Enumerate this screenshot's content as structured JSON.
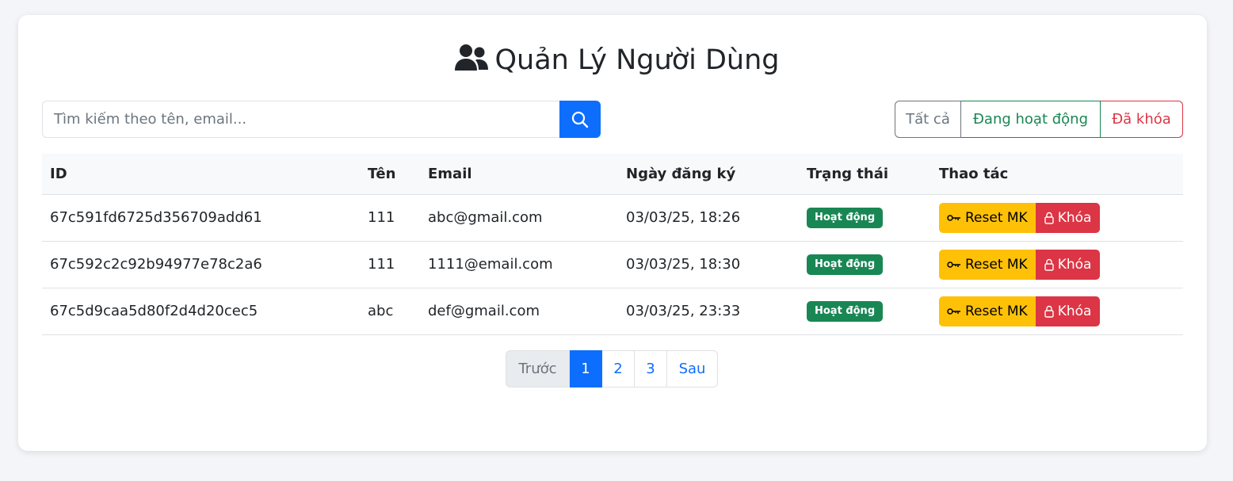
{
  "page": {
    "title": "Quản Lý Người Dùng"
  },
  "search": {
    "placeholder": "Tìm kiếm theo tên, email...",
    "value": ""
  },
  "filters": {
    "all_label": "Tất cả",
    "active_label": "Đang hoạt động",
    "locked_label": "Đã khóa"
  },
  "table": {
    "headers": {
      "id": "ID",
      "name": "Tên",
      "email": "Email",
      "registered": "Ngày đăng ký",
      "status": "Trạng thái",
      "actions": "Thao tác"
    },
    "rows": [
      {
        "id": "67c591fd6725d356709add61",
        "name": "111",
        "email": "abc@gmail.com",
        "registered": "03/03/25, 18:26",
        "status": "Hoạt động",
        "reset_label": "Reset MK",
        "lock_label": "Khóa"
      },
      {
        "id": "67c592c2c92b94977e78c2a6",
        "name": "111",
        "email": "1111@email.com",
        "registered": "03/03/25, 18:30",
        "status": "Hoạt động",
        "reset_label": "Reset MK",
        "lock_label": "Khóa"
      },
      {
        "id": "67c5d9caa5d80f2d4d20cec5",
        "name": "abc",
        "email": "def@gmail.com",
        "registered": "03/03/25, 23:33",
        "status": "Hoạt động",
        "reset_label": "Reset MK",
        "lock_label": "Khóa"
      }
    ]
  },
  "pagination": {
    "prev_label": "Trước",
    "pages": [
      "1",
      "2",
      "3"
    ],
    "current_page": "1",
    "next_label": "Sau"
  },
  "icons": {
    "title": "users-icon",
    "search": "search-icon",
    "reset": "key-icon",
    "lock": "lock-icon"
  },
  "colors": {
    "primary": "#0d6efd",
    "success": "#198754",
    "danger": "#dc3545",
    "warning": "#ffc107",
    "secondary": "#6c757d",
    "background": "#f4f5f8"
  }
}
